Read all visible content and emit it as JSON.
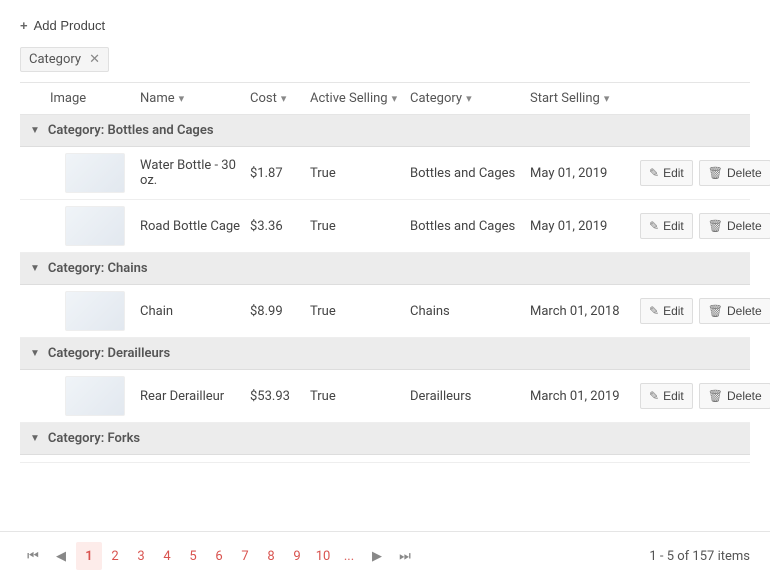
{
  "toolbar": {
    "add_label": "Add Product"
  },
  "group_chip": {
    "label": "Category"
  },
  "columns": {
    "image": "Image",
    "name": "Name",
    "cost": "Cost",
    "active": "Active Selling",
    "category": "Category",
    "start": "Start Selling"
  },
  "groups": [
    {
      "header": "Category: Bottles and Cages",
      "rows": [
        {
          "name": "Water Bottle - 30 oz.",
          "cost": "$1.87",
          "active": "True",
          "category": "Bottles and Cages",
          "start": "May 01, 2019"
        },
        {
          "name": "Road Bottle Cage",
          "cost": "$3.36",
          "active": "True",
          "category": "Bottles and Cages",
          "start": "May 01, 2019"
        }
      ]
    },
    {
      "header": "Category: Chains",
      "rows": [
        {
          "name": "Chain",
          "cost": "$8.99",
          "active": "True",
          "category": "Chains",
          "start": "March 01, 2018"
        }
      ]
    },
    {
      "header": "Category: Derailleurs",
      "rows": [
        {
          "name": "Rear Derailleur",
          "cost": "$53.93",
          "active": "True",
          "category": "Derailleurs",
          "start": "March 01, 2019"
        }
      ]
    },
    {
      "header": "Category: Forks",
      "rows": []
    }
  ],
  "actions": {
    "edit": "Edit",
    "delete": "Delete"
  },
  "pager": {
    "pages": [
      "1",
      "2",
      "3",
      "4",
      "5",
      "6",
      "7",
      "8",
      "9",
      "10",
      "..."
    ],
    "active": "1",
    "status": "1 - 5 of 157 items"
  }
}
